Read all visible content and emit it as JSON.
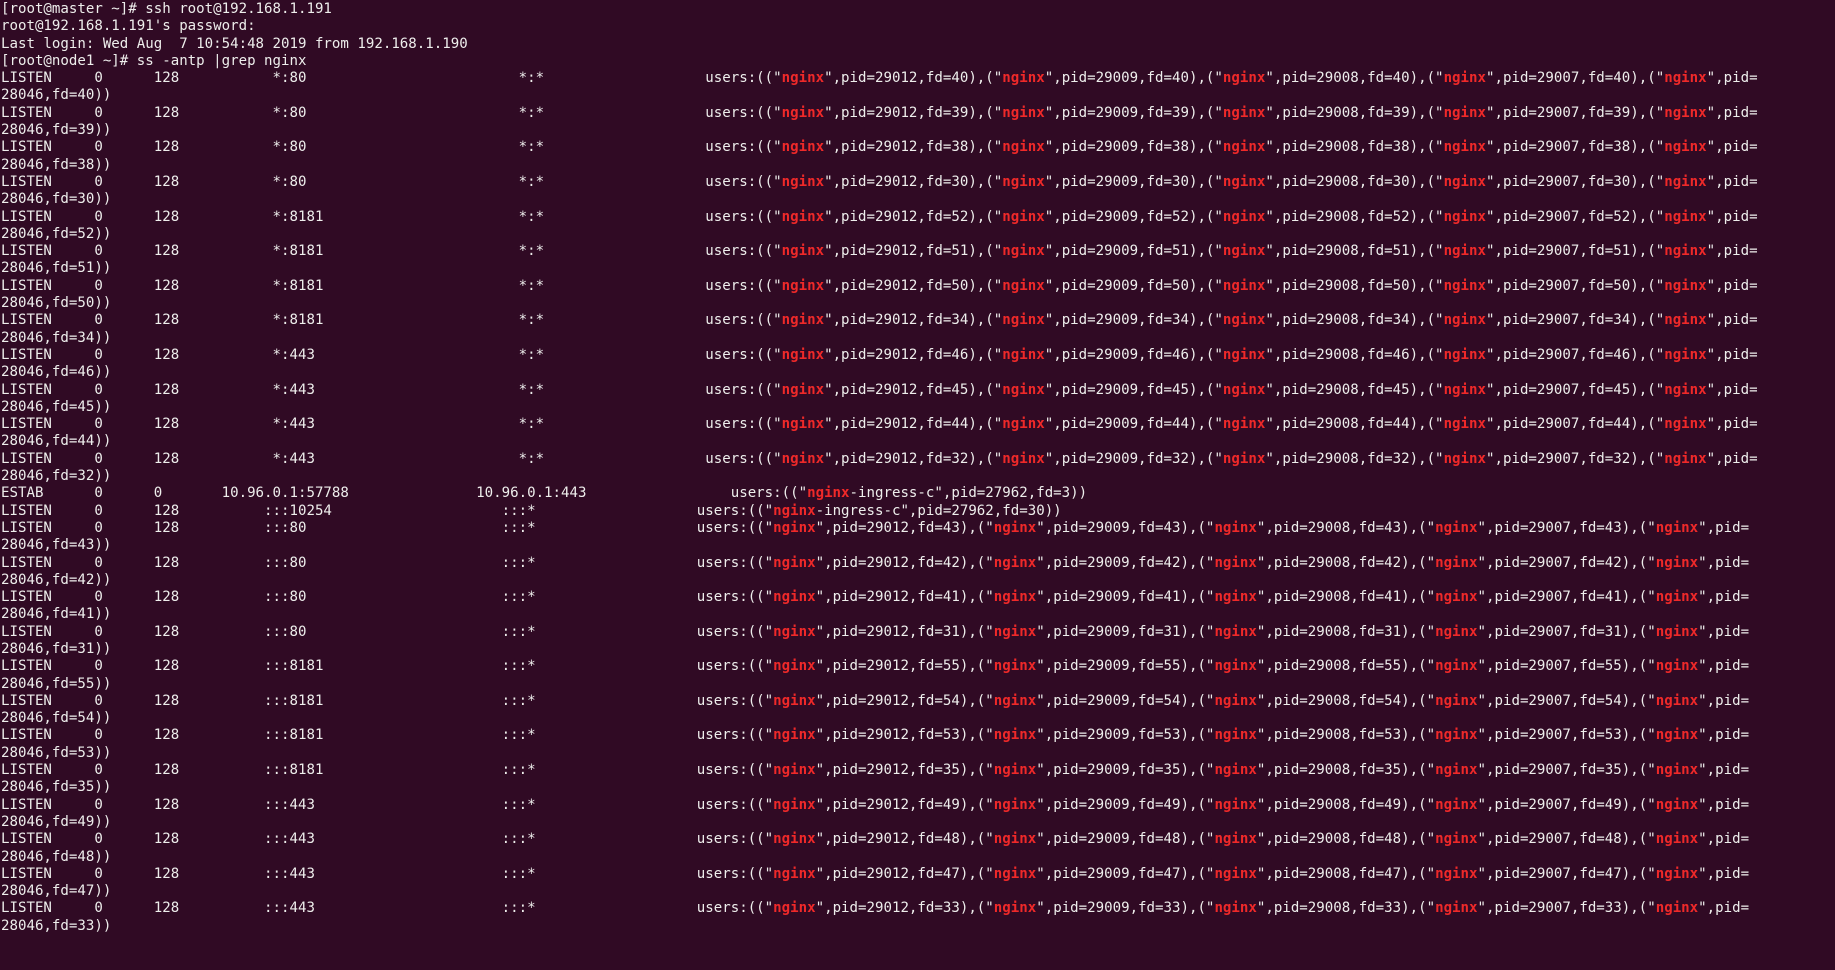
{
  "theme": {
    "background": "#300a24",
    "foreground": "#eeeeec",
    "match_highlight": "#ef2929"
  },
  "grep_pattern": "nginx",
  "lines": [
    "[root@master ~]# ssh root@192.168.1.191",
    "root@192.168.1.191's password:",
    "Last login: Wed Aug  7 10:54:48 2019 from 192.168.1.190",
    "[root@node1 ~]# ss -antp |grep nginx",
    "LISTEN     0      128           *:80                         *:*                   users:((\"nginx\",pid=29012,fd=40),(\"nginx\",pid=29009,fd=40),(\"nginx\",pid=29008,fd=40),(\"nginx\",pid=29007,fd=40),(\"nginx\",pid=",
    "28046,fd=40))",
    "LISTEN     0      128           *:80                         *:*                   users:((\"nginx\",pid=29012,fd=39),(\"nginx\",pid=29009,fd=39),(\"nginx\",pid=29008,fd=39),(\"nginx\",pid=29007,fd=39),(\"nginx\",pid=",
    "28046,fd=39))",
    "LISTEN     0      128           *:80                         *:*                   users:((\"nginx\",pid=29012,fd=38),(\"nginx\",pid=29009,fd=38),(\"nginx\",pid=29008,fd=38),(\"nginx\",pid=29007,fd=38),(\"nginx\",pid=",
    "28046,fd=38))",
    "LISTEN     0      128           *:80                         *:*                   users:((\"nginx\",pid=29012,fd=30),(\"nginx\",pid=29009,fd=30),(\"nginx\",pid=29008,fd=30),(\"nginx\",pid=29007,fd=30),(\"nginx\",pid=",
    "28046,fd=30))",
    "LISTEN     0      128           *:8181                       *:*                   users:((\"nginx\",pid=29012,fd=52),(\"nginx\",pid=29009,fd=52),(\"nginx\",pid=29008,fd=52),(\"nginx\",pid=29007,fd=52),(\"nginx\",pid=",
    "28046,fd=52))",
    "LISTEN     0      128           *:8181                       *:*                   users:((\"nginx\",pid=29012,fd=51),(\"nginx\",pid=29009,fd=51),(\"nginx\",pid=29008,fd=51),(\"nginx\",pid=29007,fd=51),(\"nginx\",pid=",
    "28046,fd=51))",
    "LISTEN     0      128           *:8181                       *:*                   users:((\"nginx\",pid=29012,fd=50),(\"nginx\",pid=29009,fd=50),(\"nginx\",pid=29008,fd=50),(\"nginx\",pid=29007,fd=50),(\"nginx\",pid=",
    "28046,fd=50))",
    "LISTEN     0      128           *:8181                       *:*                   users:((\"nginx\",pid=29012,fd=34),(\"nginx\",pid=29009,fd=34),(\"nginx\",pid=29008,fd=34),(\"nginx\",pid=29007,fd=34),(\"nginx\",pid=",
    "28046,fd=34))",
    "LISTEN     0      128           *:443                        *:*                   users:((\"nginx\",pid=29012,fd=46),(\"nginx\",pid=29009,fd=46),(\"nginx\",pid=29008,fd=46),(\"nginx\",pid=29007,fd=46),(\"nginx\",pid=",
    "28046,fd=46))",
    "LISTEN     0      128           *:443                        *:*                   users:((\"nginx\",pid=29012,fd=45),(\"nginx\",pid=29009,fd=45),(\"nginx\",pid=29008,fd=45),(\"nginx\",pid=29007,fd=45),(\"nginx\",pid=",
    "28046,fd=45))",
    "LISTEN     0      128           *:443                        *:*                   users:((\"nginx\",pid=29012,fd=44),(\"nginx\",pid=29009,fd=44),(\"nginx\",pid=29008,fd=44),(\"nginx\",pid=29007,fd=44),(\"nginx\",pid=",
    "28046,fd=44))",
    "LISTEN     0      128           *:443                        *:*                   users:((\"nginx\",pid=29012,fd=32),(\"nginx\",pid=29009,fd=32),(\"nginx\",pid=29008,fd=32),(\"nginx\",pid=29007,fd=32),(\"nginx\",pid=",
    "28046,fd=32))",
    "ESTAB      0      0       10.96.0.1:57788               10.96.0.1:443                 users:((\"nginx-ingress-c\",pid=27962,fd=3))",
    "LISTEN     0      128          :::10254                    :::*                   users:((\"nginx-ingress-c\",pid=27962,fd=30))",
    "LISTEN     0      128          :::80                       :::*                   users:((\"nginx\",pid=29012,fd=43),(\"nginx\",pid=29009,fd=43),(\"nginx\",pid=29008,fd=43),(\"nginx\",pid=29007,fd=43),(\"nginx\",pid=",
    "28046,fd=43))",
    "LISTEN     0      128          :::80                       :::*                   users:((\"nginx\",pid=29012,fd=42),(\"nginx\",pid=29009,fd=42),(\"nginx\",pid=29008,fd=42),(\"nginx\",pid=29007,fd=42),(\"nginx\",pid=",
    "28046,fd=42))",
    "LISTEN     0      128          :::80                       :::*                   users:((\"nginx\",pid=29012,fd=41),(\"nginx\",pid=29009,fd=41),(\"nginx\",pid=29008,fd=41),(\"nginx\",pid=29007,fd=41),(\"nginx\",pid=",
    "28046,fd=41))",
    "LISTEN     0      128          :::80                       :::*                   users:((\"nginx\",pid=29012,fd=31),(\"nginx\",pid=29009,fd=31),(\"nginx\",pid=29008,fd=31),(\"nginx\",pid=29007,fd=31),(\"nginx\",pid=",
    "28046,fd=31))",
    "LISTEN     0      128          :::8181                     :::*                   users:((\"nginx\",pid=29012,fd=55),(\"nginx\",pid=29009,fd=55),(\"nginx\",pid=29008,fd=55),(\"nginx\",pid=29007,fd=55),(\"nginx\",pid=",
    "28046,fd=55))",
    "LISTEN     0      128          :::8181                     :::*                   users:((\"nginx\",pid=29012,fd=54),(\"nginx\",pid=29009,fd=54),(\"nginx\",pid=29008,fd=54),(\"nginx\",pid=29007,fd=54),(\"nginx\",pid=",
    "28046,fd=54))",
    "LISTEN     0      128          :::8181                     :::*                   users:((\"nginx\",pid=29012,fd=53),(\"nginx\",pid=29009,fd=53),(\"nginx\",pid=29008,fd=53),(\"nginx\",pid=29007,fd=53),(\"nginx\",pid=",
    "28046,fd=53))",
    "LISTEN     0      128          :::8181                     :::*                   users:((\"nginx\",pid=29012,fd=35),(\"nginx\",pid=29009,fd=35),(\"nginx\",pid=29008,fd=35),(\"nginx\",pid=29007,fd=35),(\"nginx\",pid=",
    "28046,fd=35))",
    "LISTEN     0      128          :::443                      :::*                   users:((\"nginx\",pid=29012,fd=49),(\"nginx\",pid=29009,fd=49),(\"nginx\",pid=29008,fd=49),(\"nginx\",pid=29007,fd=49),(\"nginx\",pid=",
    "28046,fd=49))",
    "LISTEN     0      128          :::443                      :::*                   users:((\"nginx\",pid=29012,fd=48),(\"nginx\",pid=29009,fd=48),(\"nginx\",pid=29008,fd=48),(\"nginx\",pid=29007,fd=48),(\"nginx\",pid=",
    "28046,fd=48))",
    "LISTEN     0      128          :::443                      :::*                   users:((\"nginx\",pid=29012,fd=47),(\"nginx\",pid=29009,fd=47),(\"nginx\",pid=29008,fd=47),(\"nginx\",pid=29007,fd=47),(\"nginx\",pid=",
    "28046,fd=47))",
    "LISTEN     0      128          :::443                      :::*                   users:((\"nginx\",pid=29012,fd=33),(\"nginx\",pid=29009,fd=33),(\"nginx\",pid=29008,fd=33),(\"nginx\",pid=29007,fd=33),(\"nginx\",pid=",
    "28046,fd=33))"
  ]
}
